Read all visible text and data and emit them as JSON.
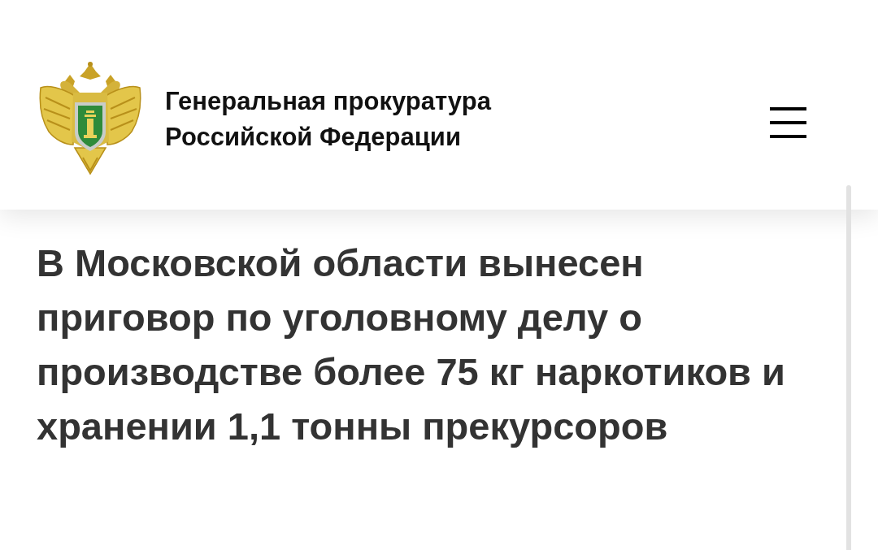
{
  "header": {
    "organization_name": "Генеральная прокуратура Российской Федерации"
  },
  "article": {
    "title": "В Московской области вынесен приговор по уголовному делу о производстве более 75 кг наркотиков и хранении 1,1 тонны прекурсоров"
  }
}
